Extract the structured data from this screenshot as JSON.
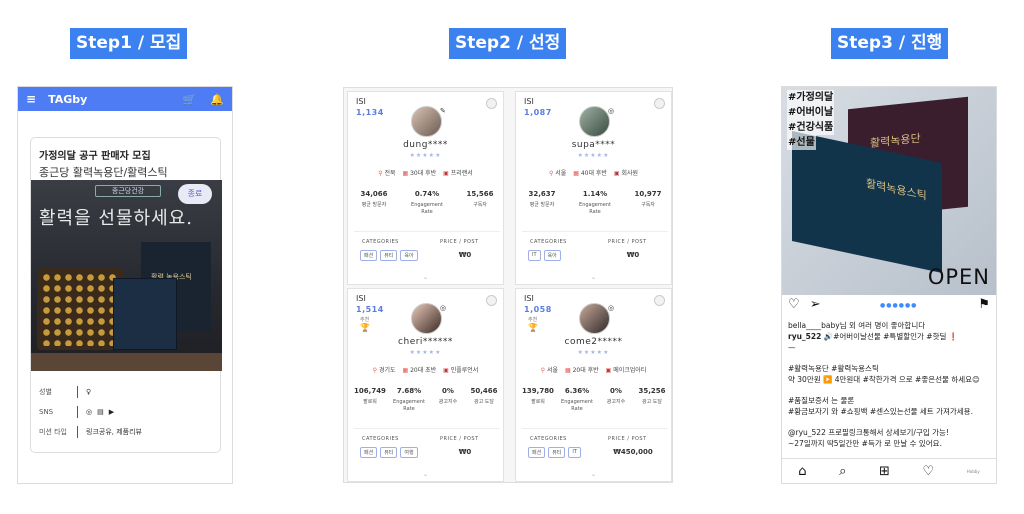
{
  "steps": [
    {
      "label": "Step1 / 모집"
    },
    {
      "label": "Step2 / 선정"
    },
    {
      "label": "Step3 / 진행"
    }
  ],
  "step1": {
    "app_title": "TAGby",
    "recruit_title": "가정의달 공구 판매자 모집",
    "product_name": "종근당 활력녹용단/활력스틱",
    "brand_logo": "종근당건강",
    "slogan": "활력을 선물하세요.",
    "status_badge": "종료",
    "box_label": "활력 녹용스틱",
    "rows": [
      {
        "key": "성별",
        "value": "♀"
      },
      {
        "key": "SNS",
        "value": ""
      },
      {
        "key": "미션 타입",
        "value": "링크공유, 제품리뷰"
      }
    ],
    "sns_icons": [
      "instagram-icon",
      "blog-icon",
      "youtube-icon"
    ]
  },
  "step2": {
    "categories_header": "CATEGORIES",
    "price_header": "PRICE / POST",
    "candidates": [
      {
        "isi_label": "ISI",
        "isi": "1,134",
        "tag": "",
        "name": "dung****",
        "location": "전북",
        "age": "30대 후반",
        "job": "프리랜서",
        "stats": [
          {
            "n": "34,066",
            "l": "평균 방문자"
          },
          {
            "n": "0.74%",
            "l": "Engagement Rate"
          },
          {
            "n": "15,566",
            "l": "구독자"
          }
        ],
        "chips": [
          "패션",
          "뷰티",
          "육아"
        ],
        "price": "₩0"
      },
      {
        "isi_label": "ISI",
        "isi": "1,087",
        "tag": "",
        "name": "supa****",
        "location": "서울",
        "age": "40대 후반",
        "job": "회사원",
        "stats": [
          {
            "n": "32,637",
            "l": "평균 방문자"
          },
          {
            "n": "1.14%",
            "l": "Engagement Rate"
          },
          {
            "n": "10,977",
            "l": "구독자"
          }
        ],
        "chips": [
          "IT",
          "육아"
        ],
        "price": "₩0"
      },
      {
        "isi_label": "ISI",
        "isi": "1,514",
        "tag": "추천",
        "name": "cheri******",
        "location": "경기도",
        "age": "20대 초반",
        "job": "인플루언서",
        "stats": [
          {
            "n": "106,749",
            "l": "팔로워"
          },
          {
            "n": "7.68%",
            "l": "Engagement Rate"
          },
          {
            "n": "0%",
            "l": "광고지수"
          },
          {
            "n": "50,466",
            "l": "광고 도달"
          }
        ],
        "chips": [
          "패션",
          "뷰티",
          "여행"
        ],
        "price": "₩0"
      },
      {
        "isi_label": "ISI",
        "isi": "1,058",
        "tag": "추천",
        "name": "come2*****",
        "location": "서울",
        "age": "20대 후반",
        "job": "메이크업아티",
        "stats": [
          {
            "n": "139,780",
            "l": "팔로워"
          },
          {
            "n": "6.36%",
            "l": "Engagement Rate"
          },
          {
            "n": "0%",
            "l": "광고지수"
          },
          {
            "n": "35,256",
            "l": "광고 도달"
          }
        ],
        "chips": [
          "패션",
          "뷰티",
          "IT"
        ],
        "price": "₩450,000"
      }
    ]
  },
  "step3": {
    "hashtags": [
      "#가정의달",
      "#어버이날",
      "#건강식품",
      "#선물"
    ],
    "box_a_label": "활력녹용단",
    "box_b_label": "활력녹용스틱",
    "open_text": "OPEN",
    "likes": "bella____baby님 외 여러 명이 좋아합니다",
    "caption_user": "ryu_522",
    "caption_first": "🔊#어버이날선물 #특별할인가 #핫딜 ❗",
    "caption_dash": "—",
    "lines": [
      "#활력녹용단 #활력녹용스틱",
      "약 30만원 ▶️ 4만원대 #착한가격 으로 #좋은선물 하세요😊",
      "",
      "#품질보증서 는 물론",
      "#황금보자기 와 #쇼핑백 #센스있는선물 세트 가져가세용.",
      "",
      "@ryu_522 프로필링크통해서 상세보기/구입 가능!",
      "~27일까지 딱5일간만 #득가 로 만날 수 있어요."
    ],
    "nav_profile": "Hobby"
  },
  "colors": {
    "accent": "#3b82f0",
    "app_bar": "#4d7cf4",
    "isi": "#5b7de2"
  }
}
